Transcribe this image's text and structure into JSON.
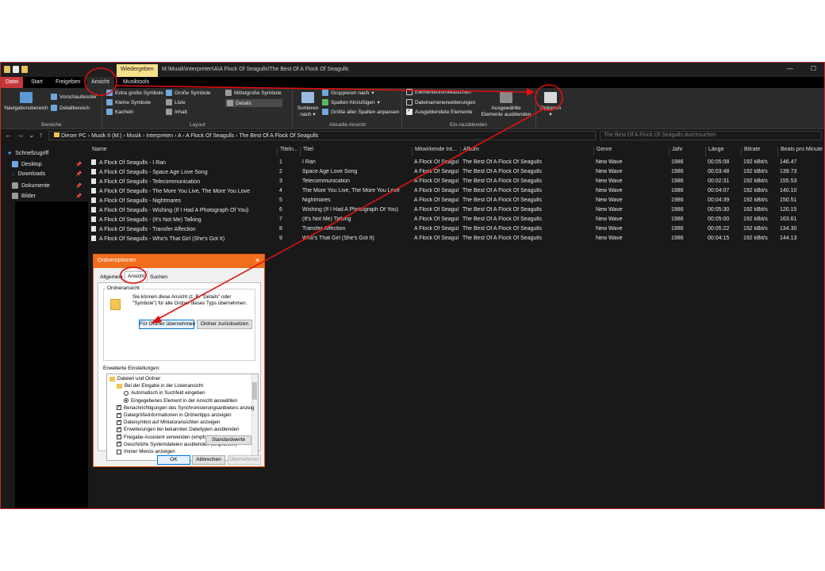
{
  "titlebar": {
    "context_tab": "Wiedergeben",
    "path": "M:\\Musik\\Interpreten\\A\\A Flock Of Seagulls\\The Best Of A Flock Of Seagulls"
  },
  "ribbon_tabs": [
    "Datei",
    "Start",
    "Freigeben",
    "Ansicht",
    "Musiktools"
  ],
  "ribbon": {
    "bereiche": {
      "nav": "Navigationsbereich",
      "preview": "Vorschaufenster",
      "details": "Detailbereich",
      "label": "Bereiche"
    },
    "layout": {
      "items": [
        "Extra große Symbole",
        "Große Symbole",
        "Mittelgroße Symbole",
        "Kleine Symbole",
        "Liste",
        "Details",
        "Kacheln",
        "Inhalt"
      ],
      "label": "Layout"
    },
    "current_view": {
      "sort_line1": "Sortieren",
      "sort_line2": "nach",
      "group": "Gruppieren nach",
      "add_cols": "Spalten hinzufügen",
      "fit_cols": "Größe aller Spalten anpassen",
      "label": "Aktuelle Ansicht"
    },
    "show_hide": {
      "checkbox1": "Elementkontrollkästchen",
      "checkbox2": "Dateinamenerweiterungen",
      "checkbox3": "Ausgeblendete Elemente",
      "hide_line1": "Ausgewählte",
      "hide_line2": "Elemente ausblenden",
      "label": "Ein-/ausblenden"
    },
    "options": "Optionen"
  },
  "address": {
    "crumbs": "Dieser PC  ›  Musik II (M:)  ›  Musik  ›  Interpreten  ›  A  ›  A Flock Of Seagulls  ›  The Best Of A Flock Of Seagulls",
    "search_placeholder": "The Best Of A Flock Of Seagulls durchsuchen"
  },
  "nav": {
    "quick_access": "Schnellzugriff",
    "items": [
      "Desktop",
      "Downloads",
      "Dokumente",
      "Bilder"
    ]
  },
  "columns": [
    "Name",
    "Titeln...",
    "Titel",
    "Mitwirkende Int...",
    "Album",
    "Genre",
    "Jahr",
    "Länge",
    "Bitrate",
    "Beats pro Minute"
  ],
  "rows": [
    {
      "name": "A Flock Of Seagulls - I Ran",
      "nr": "1",
      "title": "I Ran",
      "artist": "A Flock Of Seagulls",
      "album": "The Best Of A Flock Of Seagulls",
      "genre": "New Wave",
      "year": "1986",
      "length": "00:05:08",
      "bitrate": "192 kBit/s",
      "bpm": "146.47"
    },
    {
      "name": "A Flock Of Seagulls - Space Age Love Song",
      "nr": "2",
      "title": "Space Age Love Song",
      "artist": "A Flock Of Seagulls",
      "album": "The Best Of A Flock Of Seagulls",
      "genre": "New Wave",
      "year": "1986",
      "length": "00:03:48",
      "bitrate": "192 kBit/s",
      "bpm": "139.73"
    },
    {
      "name": "A Flock Of Seagulls - Telecommunication",
      "nr": "3",
      "title": "Telecommunication",
      "artist": "A Flock Of Seagulls",
      "album": "The Best Of A Flock Of Seagulls",
      "genre": "New Wave",
      "year": "1986",
      "length": "00:02:31",
      "bitrate": "192 kBit/s",
      "bpm": "155.53"
    },
    {
      "name": "A Flock Of Seagulls - The More You Live, The More You Love",
      "nr": "4",
      "title": "The More You Live, The More You Love",
      "artist": "A Flock Of Seagulls",
      "album": "The Best Of A Flock Of Seagulls",
      "genre": "New Wave",
      "year": "1986",
      "length": "00:04:07",
      "bitrate": "192 kBit/s",
      "bpm": "140.10"
    },
    {
      "name": "A Flock Of Seagulls - Nightmares",
      "nr": "5",
      "title": "Nightmares",
      "artist": "A Flock Of Seagulls",
      "album": "The Best Of A Flock Of Seagulls",
      "genre": "New Wave",
      "year": "1986",
      "length": "00:04:39",
      "bitrate": "192 kBit/s",
      "bpm": "150.51"
    },
    {
      "name": "A Flock Of Seagulls - Wishing (If I Had A Photograph Of You)",
      "nr": "6",
      "title": "Wishing (If I Had A Photograph Of You)",
      "artist": "A Flock Of Seagulls",
      "album": "The Best Of A Flock Of Seagulls",
      "genre": "New Wave",
      "year": "1986",
      "length": "00:05:30",
      "bitrate": "192 kBit/s",
      "bpm": "120.15"
    },
    {
      "name": "A Flock Of Seagulls - (It's Not Me) Talking",
      "nr": "7",
      "title": "(It's Not Me) Talking",
      "artist": "A Flock Of Seagulls",
      "album": "The Best Of A Flock Of Seagulls",
      "genre": "New Wave",
      "year": "1986",
      "length": "00:05:00",
      "bitrate": "192 kBit/s",
      "bpm": "163.61"
    },
    {
      "name": "A Flock Of Seagulls - Transfer Affection",
      "nr": "8",
      "title": "Transfer Affection",
      "artist": "A Flock Of Seagulls",
      "album": "The Best Of A Flock Of Seagulls",
      "genre": "New Wave",
      "year": "1986",
      "length": "00:05:22",
      "bitrate": "192 kBit/s",
      "bpm": "134.30"
    },
    {
      "name": "A Flock Of Seagulls - Who's That Girl (She's Got It)",
      "nr": "9",
      "title": "Who's That Girl (She's Got It)",
      "artist": "A Flock Of Seagulls",
      "album": "The Best Of A Flock Of Seagulls",
      "genre": "New Wave",
      "year": "1986",
      "length": "00:04:15",
      "bitrate": "192 kBit/s",
      "bpm": "144.13"
    }
  ],
  "dialog": {
    "title": "Ordneroptionen",
    "tabs": [
      "Allgemein",
      "Ansicht",
      "Suchen"
    ],
    "folder_view_legend": "Ordneransicht",
    "folder_view_text": "Sie können diese Ansicht (z. B. \"Details\" oder \"Symbole\") für alle Ordner dieses Typs übernehmen.",
    "apply_button": "Für Ordner übernehmen",
    "reset_button": "Ordner zurücksetzen",
    "advanced_label": "Erweiterte Einstellungen:",
    "tree": [
      {
        "kind": "folder",
        "indent": 0,
        "text": "Dateien und Ordner"
      },
      {
        "kind": "folder",
        "indent": 1,
        "text": "Bei der Eingabe in der Listenansicht"
      },
      {
        "kind": "radio",
        "on": false,
        "indent": 2,
        "text": "Automatisch in Suchfeld eingeben"
      },
      {
        "kind": "radio",
        "on": true,
        "indent": 2,
        "text": "Eingegebenes Element in der Ansicht auswählen"
      },
      {
        "kind": "check",
        "on": true,
        "indent": 1,
        "text": "Benachrichtigungen des Synchronisierungsanbieters anzeig"
      },
      {
        "kind": "check",
        "on": true,
        "indent": 1,
        "text": "Dateigrößeinformationen in Ordnertipps anzeigen"
      },
      {
        "kind": "check",
        "on": true,
        "indent": 1,
        "text": "Dateisymbol auf Miniaturansichten anzeigen"
      },
      {
        "kind": "check",
        "on": true,
        "indent": 1,
        "text": "Erweiterungen bei bekannten Dateitypen ausblenden"
      },
      {
        "kind": "check",
        "on": true,
        "indent": 1,
        "text": "Freigabe-Assistent verwenden (empfohlen)"
      },
      {
        "kind": "check",
        "on": true,
        "indent": 1,
        "text": "Geschützte Systemdateien ausblenden (empfohlen)"
      },
      {
        "kind": "check",
        "on": false,
        "indent": 1,
        "text": "Immer Menüs anzeigen"
      }
    ],
    "defaults_button": "Standardwerte",
    "ok": "OK",
    "cancel": "Abbrechen",
    "apply": "Übernehmen"
  },
  "colors": {
    "annotation": "#e01010",
    "file_tab": "#c6373b",
    "dialog_title": "#f06e1e"
  }
}
